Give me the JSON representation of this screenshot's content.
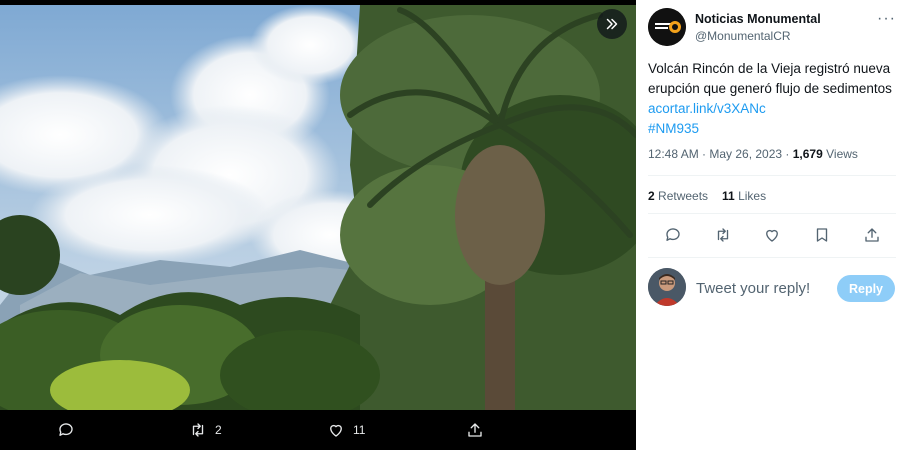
{
  "media": {
    "actions": {
      "reply_count": "",
      "retweet_count": "2",
      "like_count": "11",
      "share_count": ""
    },
    "icons": {
      "expand": "double-chevron-right-icon",
      "reply": "speech-bubble-icon",
      "retweet": "retweet-icon",
      "like": "heart-icon",
      "share": "share-icon"
    }
  },
  "tweet": {
    "author_name": "Noticias Monumental",
    "author_handle": "@MonumentalCR",
    "more_label": "···",
    "text": "Volcán Rincón de la Vieja registró nueva erupción que generó flujo de sedimentos",
    "link": "acortar.link/v3XANc",
    "hashtag": "#NM935",
    "time": "12:48 AM · May 26, 2023 · ",
    "views_count": "1,679",
    "views_label": " Views",
    "retweets_count": "2",
    "retweets_label": " Retweets",
    "likes_count": "11",
    "likes_label": " Likes"
  },
  "reply": {
    "placeholder": "Tweet your reply!",
    "button_label": "Reply"
  },
  "colors": {
    "accent": "#1d9bf0",
    "reply_button": "#8ecdf8",
    "muted_text": "#536471"
  }
}
